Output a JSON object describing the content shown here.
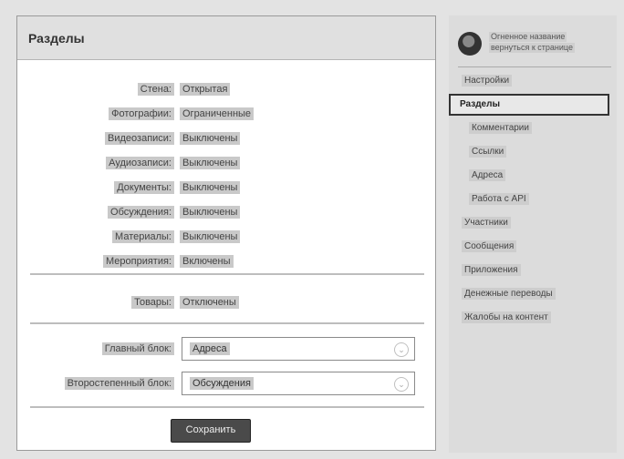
{
  "panel": {
    "title": "Разделы",
    "rows": [
      {
        "label": "Стена:",
        "value": "Открытая"
      },
      {
        "label": "Фотографии:",
        "value": "Ограниченные"
      },
      {
        "label": "Видеозаписи:",
        "value": "Выключены"
      },
      {
        "label": "Аудиозаписи:",
        "value": "Выключены"
      },
      {
        "label": "Документы:",
        "value": "Выключены"
      },
      {
        "label": "Обсуждения:",
        "value": "Выключены"
      },
      {
        "label": "Материалы:",
        "value": "Выключены"
      },
      {
        "label": "Мероприятия:",
        "value": "Включены"
      }
    ],
    "goods": {
      "label": "Товары:",
      "value": "Отключены"
    },
    "main_block": {
      "label": "Главный блок:",
      "value": "Адреса"
    },
    "secondary_block": {
      "label": "Второстепенный блок:",
      "value": "Обсуждения"
    },
    "save_label": "Сохранить"
  },
  "sidebar": {
    "profile_line1": "Огненное название",
    "profile_line2": "вернуться к странице",
    "items": [
      {
        "label": "Настройки"
      },
      {
        "label": "Разделы",
        "active": true
      },
      {
        "label": "Комментарии",
        "sub": true
      },
      {
        "label": "Ссылки",
        "sub": true
      },
      {
        "label": "Адреса",
        "sub": true
      },
      {
        "label": "Работа с API",
        "sub": true
      },
      {
        "label": "Участники"
      },
      {
        "label": "Сообщения"
      },
      {
        "label": "Приложения"
      },
      {
        "label": "Денежные переводы"
      },
      {
        "label": "Жалобы на контент"
      }
    ]
  }
}
